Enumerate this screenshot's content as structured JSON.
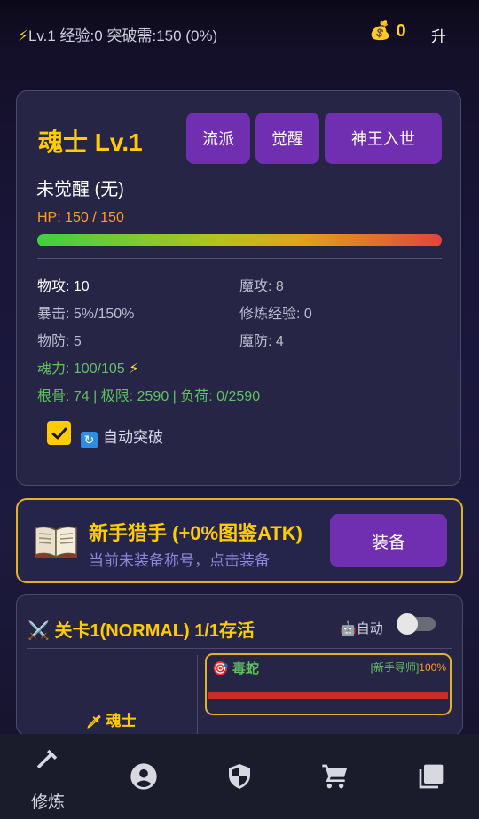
{
  "topbar": {
    "bolt_icon": "⚡",
    "level": "Lv.1",
    "exp": "经验:0",
    "breakthrough": "突破需:150 (0%)",
    "money_icon": "💰",
    "money": "0",
    "upgrade_label": "升"
  },
  "character": {
    "name": "魂士 Lv.1",
    "buttons": [
      "流派",
      "觉醒",
      "神王入世"
    ],
    "awakening": "未觉醒 (无)",
    "hp_text": "HP: 150 / 150",
    "hp_fraction": 1.0,
    "stats": {
      "phys_atk_label": "物攻:",
      "phys_atk_value": "10",
      "mag_atk": "魔攻: 8",
      "crit": "暴击: 5%/150%",
      "cult_exp": "修炼经验: 0",
      "phys_def": "物防: 5",
      "mag_def": "魔防: 4",
      "soul_power": "魂力: 100/105",
      "soul_icon": "⚡",
      "bone": "根骨: 74 | 极限: 2590 | 负荷: 0/2590"
    },
    "auto_breakthrough": {
      "checked": true,
      "icon": "🔄",
      "label": "自动突破"
    }
  },
  "title_card": {
    "icon": "open-book-icon",
    "title": "新手猎手 (+0%图鉴ATK)",
    "subtitle": "当前未装备称号，点击装备",
    "equip_label": "装备"
  },
  "stage": {
    "icon": "⚔️",
    "title": "关卡1(NORMAL) 1/1存活",
    "auto_icon": "🤖",
    "auto_label": "自动",
    "auto_enabled": false,
    "hero_icon": "🗡",
    "hero_name": "魂士",
    "enemy": {
      "icon": "🎯",
      "name": "毒蛇",
      "tag": "[新手导师]",
      "percent": "100%",
      "hp_fraction": 1.0
    }
  },
  "nav": {
    "items": [
      {
        "icon": "hammer-icon",
        "label": "修炼",
        "active": true
      },
      {
        "icon": "account-circle-icon",
        "label": ""
      },
      {
        "icon": "shield-icon",
        "label": ""
      },
      {
        "icon": "cart-icon",
        "label": ""
      },
      {
        "icon": "library-icon",
        "label": ""
      }
    ]
  },
  "colors": {
    "accent_purple": "#6f2fb0",
    "gold": "#ffcc00",
    "green": "#5fc25f",
    "hp_orange": "#ff9a2e",
    "enemy_bar_red": "#cc2a2a"
  }
}
